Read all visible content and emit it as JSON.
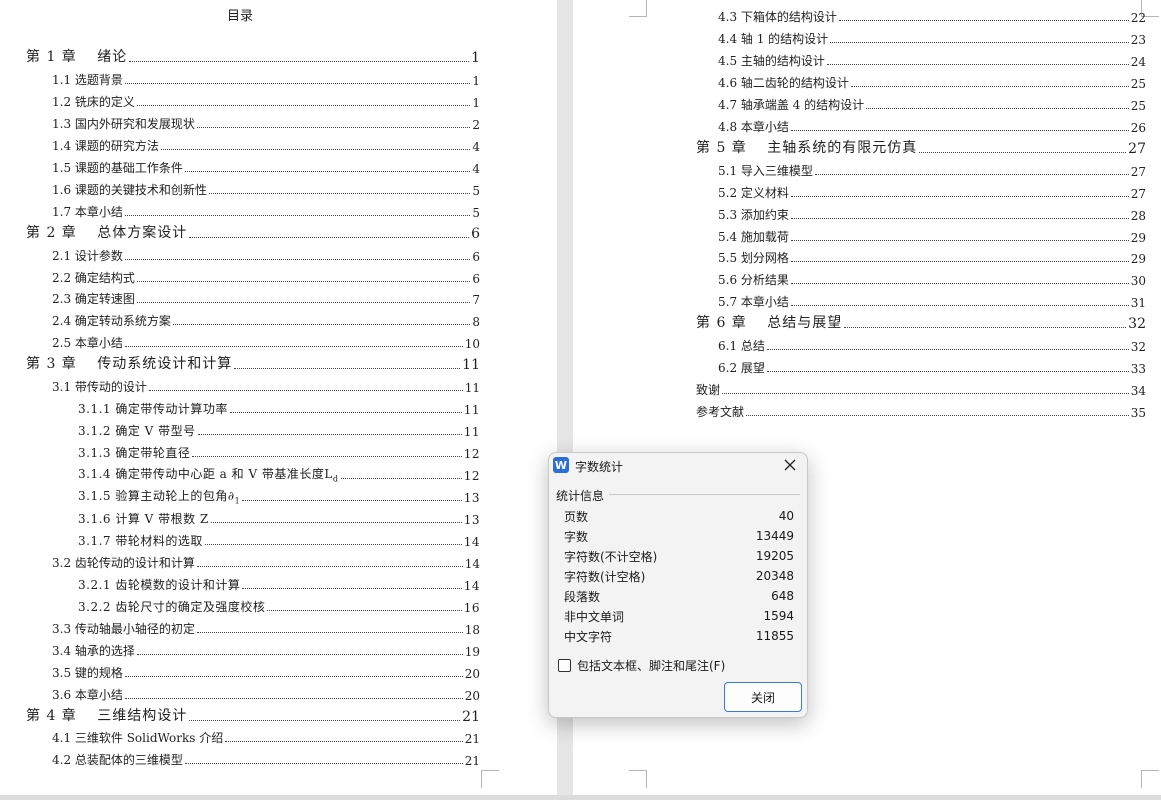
{
  "toc": {
    "title": "目录",
    "left_entries": [
      {
        "label": "第 1 章　 绪论",
        "page": "1",
        "level": "chapter"
      },
      {
        "label": "1.1 选题背景",
        "page": "1",
        "level": "section"
      },
      {
        "label": "1.2 铣床的定义",
        "page": "1",
        "level": "section"
      },
      {
        "label": "1.3 国内外研究和发展现状",
        "page": "2",
        "level": "section"
      },
      {
        "label": "1.4 课题的研究方法",
        "page": "4",
        "level": "section"
      },
      {
        "label": "1.5 课题的基础工作条件",
        "page": "4",
        "level": "section"
      },
      {
        "label": "1.6 课题的关键技术和创新性",
        "page": "5",
        "level": "section"
      },
      {
        "label": "1.7 本章小结",
        "page": "5",
        "level": "section"
      },
      {
        "label": "第 2 章　 总体方案设计",
        "page": "6",
        "level": "chapter"
      },
      {
        "label": "2.1 设计参数",
        "page": "6",
        "level": "section"
      },
      {
        "label": "2.2 确定结构式",
        "page": "6",
        "level": "section"
      },
      {
        "label": "2.3 确定转速图",
        "page": "7",
        "level": "section"
      },
      {
        "label": "2.4 确定转动系统方案",
        "page": "8",
        "level": "section"
      },
      {
        "label": "2.5 本章小结",
        "page": "10",
        "level": "section"
      },
      {
        "label": "第 3 章　 传动系统设计和计算",
        "page": "11",
        "level": "chapter"
      },
      {
        "label": "3.1 带传动的设计",
        "page": "11",
        "level": "section"
      },
      {
        "label": "3.1.1 确定带传动计算功率",
        "page": "11",
        "level": "sub"
      },
      {
        "label": "3.1.2 确定 V 带型号",
        "page": "11",
        "level": "sub"
      },
      {
        "label": "3.1.3 确定带轮直径",
        "page": "12",
        "level": "sub"
      },
      {
        "label": "3.1.4 确定带传动中心距 a 和 V 带基准长度L",
        "suffix": "d",
        "page": "12",
        "level": "sub"
      },
      {
        "label": "3.1.5 验算主动轮上的包角∂",
        "suffix": "1",
        "page": "13",
        "level": "sub"
      },
      {
        "label": "3.1.6 计算 V 带根数 Z",
        "page": "13",
        "level": "sub"
      },
      {
        "label": "3.1.7 带轮材料的选取",
        "page": "14",
        "level": "sub"
      },
      {
        "label": "3.2 齿轮传动的设计和计算",
        "page": "14",
        "level": "section"
      },
      {
        "label": "3.2.1 齿轮模数的设计和计算",
        "page": "14",
        "level": "sub"
      },
      {
        "label": "3.2.2 齿轮尺寸的确定及强度校核",
        "page": "16",
        "level": "sub"
      },
      {
        "label": "3.3 传动轴最小轴径的初定",
        "page": "18",
        "level": "section"
      },
      {
        "label": "3.4 轴承的选择",
        "page": "19",
        "level": "section"
      },
      {
        "label": "3.5 键的规格",
        "page": "20",
        "level": "section"
      },
      {
        "label": "3.6 本章小结",
        "page": "20",
        "level": "section"
      },
      {
        "label": "第 4 章　 三维结构设计",
        "page": "21",
        "level": "chapter"
      },
      {
        "label": "4.1 三维软件 SolidWorks 介绍",
        "page": "21",
        "level": "section"
      },
      {
        "label": "4.2 总装配体的三维模型",
        "page": "21",
        "level": "section"
      }
    ],
    "right_entries": [
      {
        "label": "4.3 下箱体的结构设计",
        "page": "22",
        "level": "section"
      },
      {
        "label": "4.4 轴 1 的结构设计",
        "page": "23",
        "level": "section"
      },
      {
        "label": "4.5 主轴的结构设计",
        "page": "24",
        "level": "section"
      },
      {
        "label": "4.6 轴二齿轮的结构设计",
        "page": "25",
        "level": "section"
      },
      {
        "label": "4.7 轴承端盖 4 的结构设计",
        "page": "25",
        "level": "section"
      },
      {
        "label": "4.8 本章小结",
        "page": "26",
        "level": "section"
      },
      {
        "label": "第 5 章　 主轴系统的有限元仿真",
        "page": "27",
        "level": "chapter"
      },
      {
        "label": "5.1 导入三维模型",
        "page": "27",
        "level": "section"
      },
      {
        "label": "5.2 定义材料",
        "page": "27",
        "level": "section"
      },
      {
        "label": "5.3 添加约束",
        "page": "28",
        "level": "section"
      },
      {
        "label": "5.4 施加载荷",
        "page": "29",
        "level": "section"
      },
      {
        "label": "5.5 划分网格",
        "page": "29",
        "level": "section"
      },
      {
        "label": "5.6 分析结果",
        "page": "30",
        "level": "section"
      },
      {
        "label": "5.7 本章小结",
        "page": "31",
        "level": "section"
      },
      {
        "label": "第 6 章　 总结与展望",
        "page": "32",
        "level": "chapter"
      },
      {
        "label": "6.1 总结",
        "page": "32",
        "level": "section"
      },
      {
        "label": "6.2 展望",
        "page": "33",
        "level": "section"
      },
      {
        "label": "致谢",
        "page": "34",
        "level": "top"
      },
      {
        "label": "参考文献",
        "page": "35",
        "level": "top"
      }
    ]
  },
  "dialog": {
    "title": "字数统计",
    "app_icon_letter": "W",
    "group_label": "统计信息",
    "stats": [
      {
        "label": "页数",
        "value": "40"
      },
      {
        "label": "字数",
        "value": "13449"
      },
      {
        "label": "字符数(不计空格)",
        "value": "19205"
      },
      {
        "label": "字符数(计空格)",
        "value": "20348"
      },
      {
        "label": "段落数",
        "value": "648"
      },
      {
        "label": "非中文单词",
        "value": "1594"
      },
      {
        "label": "中文字符",
        "value": "11855"
      }
    ],
    "checkbox_label": "包括文本框、脚注和尾注(F)",
    "checkbox_checked": false,
    "close_button_label": "关闭"
  }
}
